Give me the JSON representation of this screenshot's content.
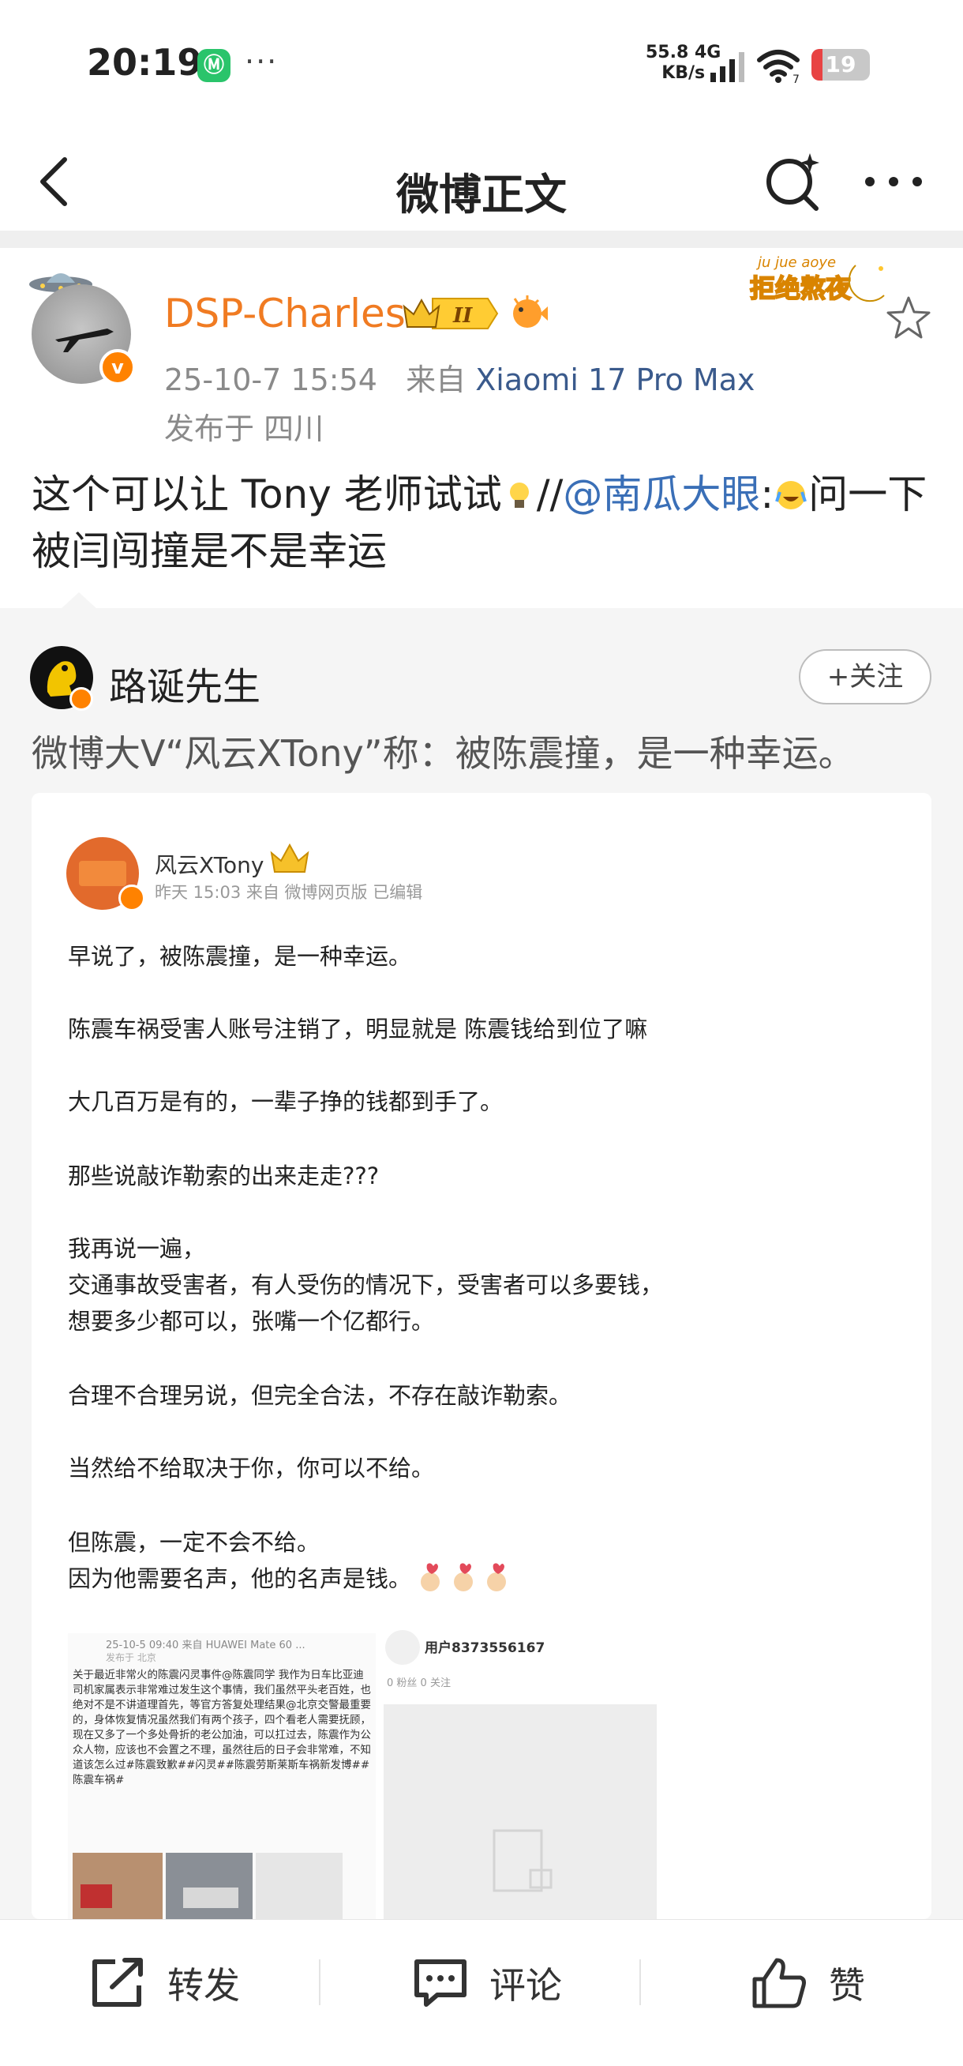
{
  "status_bar": {
    "time": "20:19",
    "app_icon_glyph": "Ⓜ",
    "dots": "···",
    "speed_value": "55.8",
    "speed_network": "4G",
    "speed_unit": "KB/s",
    "wifi_badge": "7",
    "battery_level": "19",
    "battery_fraction": 0.19
  },
  "nav": {
    "title": "微博正文"
  },
  "post": {
    "author": "DSP-Charles",
    "vip_level": "II",
    "sticker_small": "ju jue aoye",
    "sticker_text": "拒绝熬夜",
    "date": "25-10-7 15:54",
    "source_prefix": "来自",
    "device": "Xiaomi 17 Pro Max",
    "location": "发布于 四川",
    "text_part1": "这个可以让 Tony 老师试试",
    "text_part2": "//",
    "mention": "@南瓜大眼",
    "text_part3": ":",
    "text_part4": "问一下被闫闯撞是不是幸运"
  },
  "repost": {
    "author": "路诞先生",
    "follow_label": "+关注",
    "text": "微博大V“风云XTony”称：被陈震撞，是一种幸运。"
  },
  "embed": {
    "author": "风云XTony",
    "meta": "昨天 15:03 来自 微博网页版 已编辑",
    "lines": [
      "早说了，被陈震撞，是一种幸运。",
      "陈震车祸受害人账号注销了，明显就是 陈震钱给到位了嘛",
      "大几百万是有的，一辈子挣的钱都到手了。",
      "那些说敲诈勒索的出来走走???",
      "我再说一遍，",
      "交通事故受害者，有人受伤的情况下，受害者可以多要钱，",
      "想要多少都可以，张嘴一个亿都行。",
      "合理不合理另说，但完全合法，不存在敲诈勒索。",
      "当然给不给取决于你，你可以不给。",
      "但陈震，一定不会不给。",
      "因为他需要名声，他的名声是钱。"
    ],
    "screenshot_left": {
      "header": "25-10-5 09:40  来自 HUAWEI Mate 60 ...",
      "sub": "发布于 北京",
      "body": "关于最近非常火的陈震闪灵事件@陈震同学 我作为日车比亚迪司机家属表示非常难过发生这个事情，我们虽然平头老百姓，也绝对不是不讲道理首先，等官方答复处理结果@北京交警最重要的，身体恢复情况虽然我们有两个孩子，四个看老人需要抚顾，现在又多了一个多处骨折的老公加油，可以扛过去，陈震作为公众人物，应该也不会置之不理，虽然往后的日子会非常难，不知道该怎么过#陈震致歉##闪灵##陈震劳斯莱斯车祸新发博##陈震车祸#"
    },
    "screenshot_right": {
      "user": "用户8373556167",
      "stats": "0 粉丝   0 关注"
    }
  },
  "actions": {
    "repost": "转发",
    "comment": "评论",
    "like": "赞"
  },
  "icons": [
    "back-icon",
    "search-sparkle-icon",
    "more-icon",
    "ufo-icon",
    "verified-badge-icon",
    "vip-crown-icon",
    "pufferfish-icon",
    "moon-icon",
    "star-icon",
    "share-icon",
    "comment-icon",
    "thumbs-up-icon"
  ],
  "colors": {
    "author_orange": "#f07b22",
    "link_blue": "#3a6fb7",
    "verified_orange": "#ff8200",
    "repost_bg": "#f5f5f5"
  }
}
